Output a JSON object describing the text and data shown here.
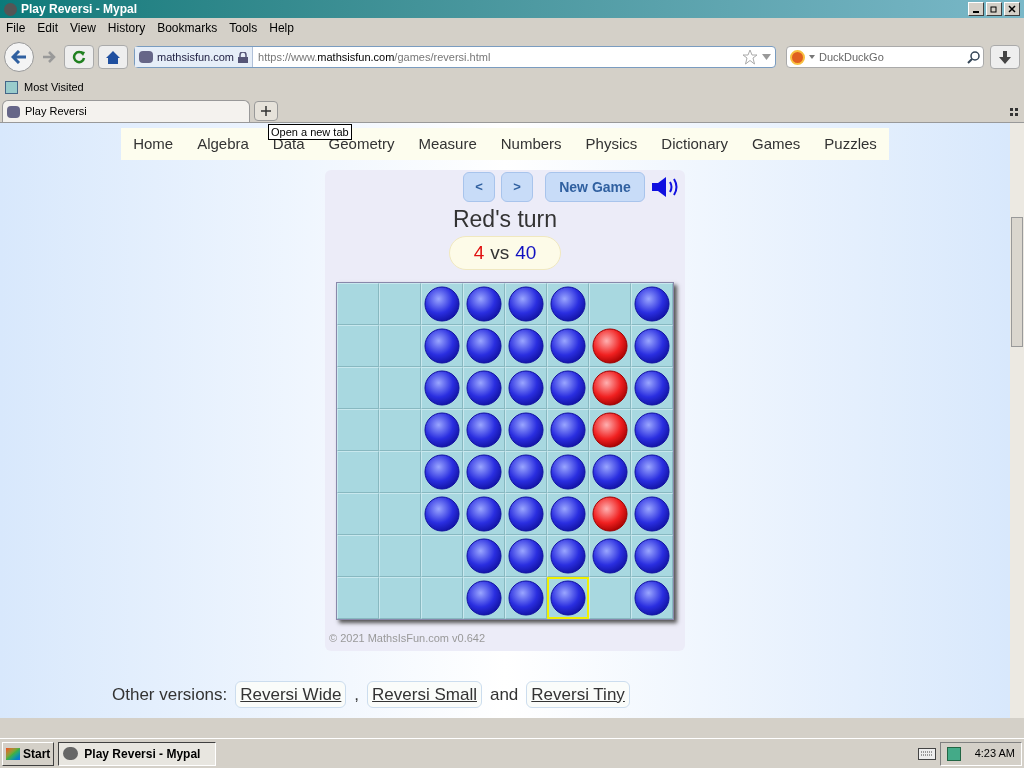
{
  "window": {
    "title": "Play Reversi - Mypal"
  },
  "menu": [
    "File",
    "Edit",
    "View",
    "History",
    "Bookmarks",
    "Tools",
    "Help"
  ],
  "address_bar": {
    "site": "mathsisfun.com",
    "url_prefix": "https://www.",
    "url_domain": "mathsisfun.com",
    "url_path": "/games/reversi.html"
  },
  "search": {
    "placeholder": "DuckDuckGo"
  },
  "bookmarks": [
    "Most Visited"
  ],
  "tabs": [
    {
      "label": "Play Reversi",
      "selected": true
    }
  ],
  "tooltip": "Open a new tab",
  "nav": [
    "Home",
    "Algebra",
    "Data",
    "Geometry",
    "Measure",
    "Numbers",
    "Physics",
    "Dictionary",
    "Games",
    "Puzzles"
  ],
  "game": {
    "prev": "<",
    "next": ">",
    "new_game": "New Game",
    "turn": "Red's turn",
    "red_score": "4",
    "vs": "vs",
    "blue_score": "40",
    "board": [
      [
        {
          "kind": "empty",
          "selected": false
        },
        {
          "kind": "empty",
          "selected": false
        },
        {
          "kind": "blue",
          "selected": false
        },
        {
          "kind": "blue",
          "selected": false
        },
        {
          "kind": "blue",
          "selected": false
        },
        {
          "kind": "blue",
          "selected": false
        },
        {
          "kind": "empty",
          "selected": false
        },
        {
          "kind": "blue",
          "selected": false
        }
      ],
      [
        {
          "kind": "empty",
          "selected": false
        },
        {
          "kind": "empty",
          "selected": false
        },
        {
          "kind": "blue",
          "selected": false
        },
        {
          "kind": "blue",
          "selected": false
        },
        {
          "kind": "blue",
          "selected": false
        },
        {
          "kind": "blue",
          "selected": false
        },
        {
          "kind": "red",
          "selected": false
        },
        {
          "kind": "blue",
          "selected": false
        }
      ],
      [
        {
          "kind": "empty",
          "selected": false
        },
        {
          "kind": "empty",
          "selected": false
        },
        {
          "kind": "blue",
          "selected": false
        },
        {
          "kind": "blue",
          "selected": false
        },
        {
          "kind": "blue",
          "selected": false
        },
        {
          "kind": "blue",
          "selected": false
        },
        {
          "kind": "red",
          "selected": false
        },
        {
          "kind": "blue",
          "selected": false
        }
      ],
      [
        {
          "kind": "empty",
          "selected": false
        },
        {
          "kind": "empty",
          "selected": false
        },
        {
          "kind": "blue",
          "selected": false
        },
        {
          "kind": "blue",
          "selected": false
        },
        {
          "kind": "blue",
          "selected": false
        },
        {
          "kind": "blue",
          "selected": false
        },
        {
          "kind": "red",
          "selected": false
        },
        {
          "kind": "blue",
          "selected": false
        }
      ],
      [
        {
          "kind": "empty",
          "selected": false
        },
        {
          "kind": "empty",
          "selected": false
        },
        {
          "kind": "blue",
          "selected": false
        },
        {
          "kind": "blue",
          "selected": false
        },
        {
          "kind": "blue",
          "selected": false
        },
        {
          "kind": "blue",
          "selected": false
        },
        {
          "kind": "blue",
          "selected": false
        },
        {
          "kind": "blue",
          "selected": false
        }
      ],
      [
        {
          "kind": "empty",
          "selected": false
        },
        {
          "kind": "empty",
          "selected": false
        },
        {
          "kind": "blue",
          "selected": false
        },
        {
          "kind": "blue",
          "selected": false
        },
        {
          "kind": "blue",
          "selected": false
        },
        {
          "kind": "blue",
          "selected": false
        },
        {
          "kind": "red",
          "selected": false
        },
        {
          "kind": "blue",
          "selected": false
        }
      ],
      [
        {
          "kind": "empty",
          "selected": false
        },
        {
          "kind": "empty",
          "selected": false
        },
        {
          "kind": "empty",
          "selected": false
        },
        {
          "kind": "blue",
          "selected": false
        },
        {
          "kind": "blue",
          "selected": false
        },
        {
          "kind": "blue",
          "selected": false
        },
        {
          "kind": "blue",
          "selected": false
        },
        {
          "kind": "blue",
          "selected": false
        }
      ],
      [
        {
          "kind": "empty",
          "selected": false
        },
        {
          "kind": "empty",
          "selected": false
        },
        {
          "kind": "empty",
          "selected": false
        },
        {
          "kind": "blue",
          "selected": false
        },
        {
          "kind": "blue",
          "selected": false
        },
        {
          "kind": "blue",
          "selected": true
        },
        {
          "kind": "empty",
          "selected": false
        },
        {
          "kind": "blue",
          "selected": false
        }
      ]
    ],
    "copyright": "© 2021 MathsIsFun.com v0.642"
  },
  "versions": {
    "label": "Other versions:",
    "links": [
      "Reversi Wide",
      "Reversi Small",
      "Reversi Tiny"
    ],
    "separators": [
      ",",
      "and"
    ]
  },
  "taskbar": {
    "start": "Start",
    "task": "Play Reversi - Mypal",
    "clock": "4:23 AM"
  }
}
